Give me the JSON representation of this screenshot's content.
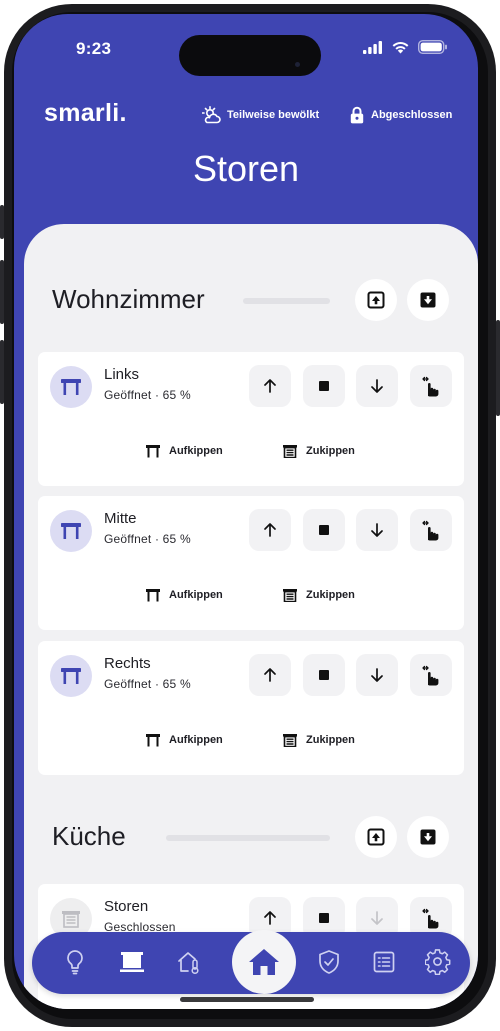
{
  "status_bar": {
    "time": "9:23"
  },
  "header": {
    "logo": "smarli.",
    "weather_label": "Teilweise bewölkt",
    "lock_label": "Abgeschlossen",
    "page_title": "Storen"
  },
  "rooms": [
    {
      "name": "Wohnzimmer",
      "devices": [
        {
          "name": "Links",
          "status": "Geöffnet · 65 %",
          "tilt_open": "Aufkippen",
          "tilt_close": "Zukippen"
        },
        {
          "name": "Mitte",
          "status": "Geöffnet · 65 %",
          "tilt_open": "Aufkippen",
          "tilt_close": "Zukippen"
        },
        {
          "name": "Rechts",
          "status": "Geöffnet · 65 %",
          "tilt_open": "Aufkippen",
          "tilt_close": "Zukippen"
        }
      ]
    },
    {
      "name": "Küche",
      "devices": [
        {
          "name": "Storen",
          "status": "Geschlossen"
        }
      ]
    }
  ],
  "bottom_nav": [
    "lightbulb-icon",
    "blinds-icon",
    "climate-icon",
    "home-icon",
    "shield-icon",
    "list-icon",
    "settings-icon"
  ],
  "colors": {
    "brand": "#3f45b2",
    "background": "#f1f1f3",
    "avatar_active": "#dcdcf3",
    "avatar_inactive": "#eeeeef"
  }
}
